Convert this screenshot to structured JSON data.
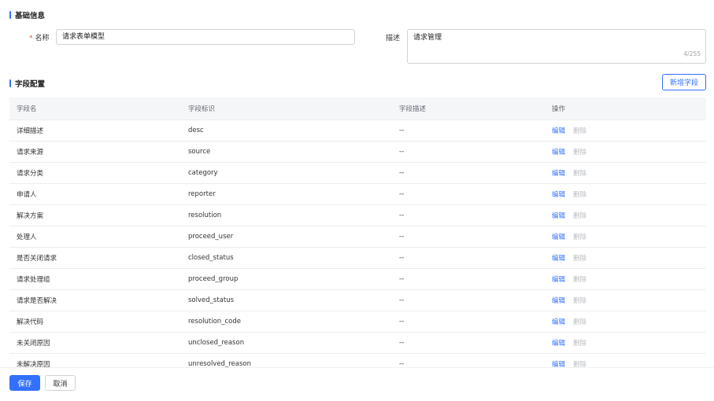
{
  "basic": {
    "title": "基础信息",
    "name_label": "名称",
    "name_value": "请求表单模型",
    "desc_label": "描述",
    "desc_value": "请求管理",
    "desc_counter": "4/255"
  },
  "fields": {
    "title": "字段配置",
    "add_button": "新增字段",
    "headers": [
      "字段名",
      "字段标识",
      "字段描述",
      "操作"
    ],
    "edit_label": "编辑",
    "delete_label": "删除",
    "rows": [
      {
        "name": "详细描述",
        "key": "desc",
        "desc": "--"
      },
      {
        "name": "请求来源",
        "key": "source",
        "desc": "--"
      },
      {
        "name": "请求分类",
        "key": "category",
        "desc": "--"
      },
      {
        "name": "申请人",
        "key": "reporter",
        "desc": "--"
      },
      {
        "name": "解决方案",
        "key": "resolution",
        "desc": "--"
      },
      {
        "name": "处理人",
        "key": "proceed_user",
        "desc": "--"
      },
      {
        "name": "是否关闭请求",
        "key": "closed_status",
        "desc": "--"
      },
      {
        "name": "请求处理组",
        "key": "proceed_group",
        "desc": "--"
      },
      {
        "name": "请求是否解决",
        "key": "solved_status",
        "desc": "--"
      },
      {
        "name": "解决代码",
        "key": "resolution_code",
        "desc": "--"
      },
      {
        "name": "未关闭原因",
        "key": "unclosed_reason",
        "desc": "--"
      },
      {
        "name": "未解决原因",
        "key": "unresolved_reason",
        "desc": "--"
      }
    ]
  },
  "footer": {
    "save_label": "保存",
    "cancel_label": "取消"
  },
  "colors": {
    "accent": "#3370ff",
    "required": "#f54a45",
    "disabled_text": "#b9bcc1"
  }
}
